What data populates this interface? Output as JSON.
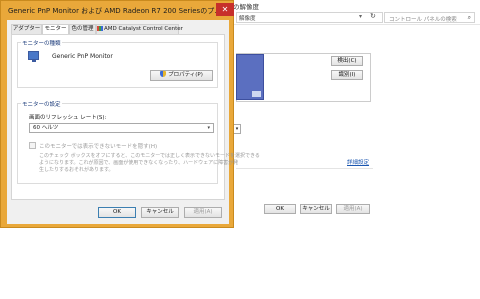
{
  "background": {
    "title": "画面の解像度",
    "breadcrumb": "解像度",
    "search_placeholder": "コントロール パネルの検索",
    "detect_button": "検出(C)",
    "identify_button": "識別(I)",
    "advanced_link": "詳細設定",
    "ok": "OK",
    "cancel": "キャンセル",
    "apply": "適用(A)"
  },
  "dialog": {
    "title": "Generic PnP Monitor および AMD Radeon R7 200 Seriesのプ...",
    "close_glyph": "✕",
    "tabs": [
      {
        "label": "アダプター"
      },
      {
        "label": "モニター"
      },
      {
        "label": "色の管理"
      },
      {
        "label": "AMD Catalyst Control Center"
      }
    ],
    "active_tab": "モニター",
    "monitor_type_group": "モニターの種類",
    "monitor_name": "Generic PnP Monitor",
    "properties_button": "プロパティ(P)",
    "monitor_settings_group": "モニターの設定",
    "refresh_label": "画面のリフレッシュ レート(S):",
    "refresh_value": "60 ヘルツ",
    "hide_modes_label": "このモニターでは表示できないモードを隠す(H)",
    "note_lines": [
      "このチェック ボックスをオフにすると、このモニターでは正しく表示できないモードを選択できる",
      "ようになります。これが原因で、画面が使用できなくなったり、ハードウェアに障害が発",
      "生したりするおそれがあります。"
    ],
    "ok": "OK",
    "cancel": "キャンセル",
    "apply": "適用(A)"
  },
  "colors": {
    "dialog_frame": "#e9a83a",
    "close_button": "#c7302b",
    "group_label": "#1a3a7a"
  }
}
